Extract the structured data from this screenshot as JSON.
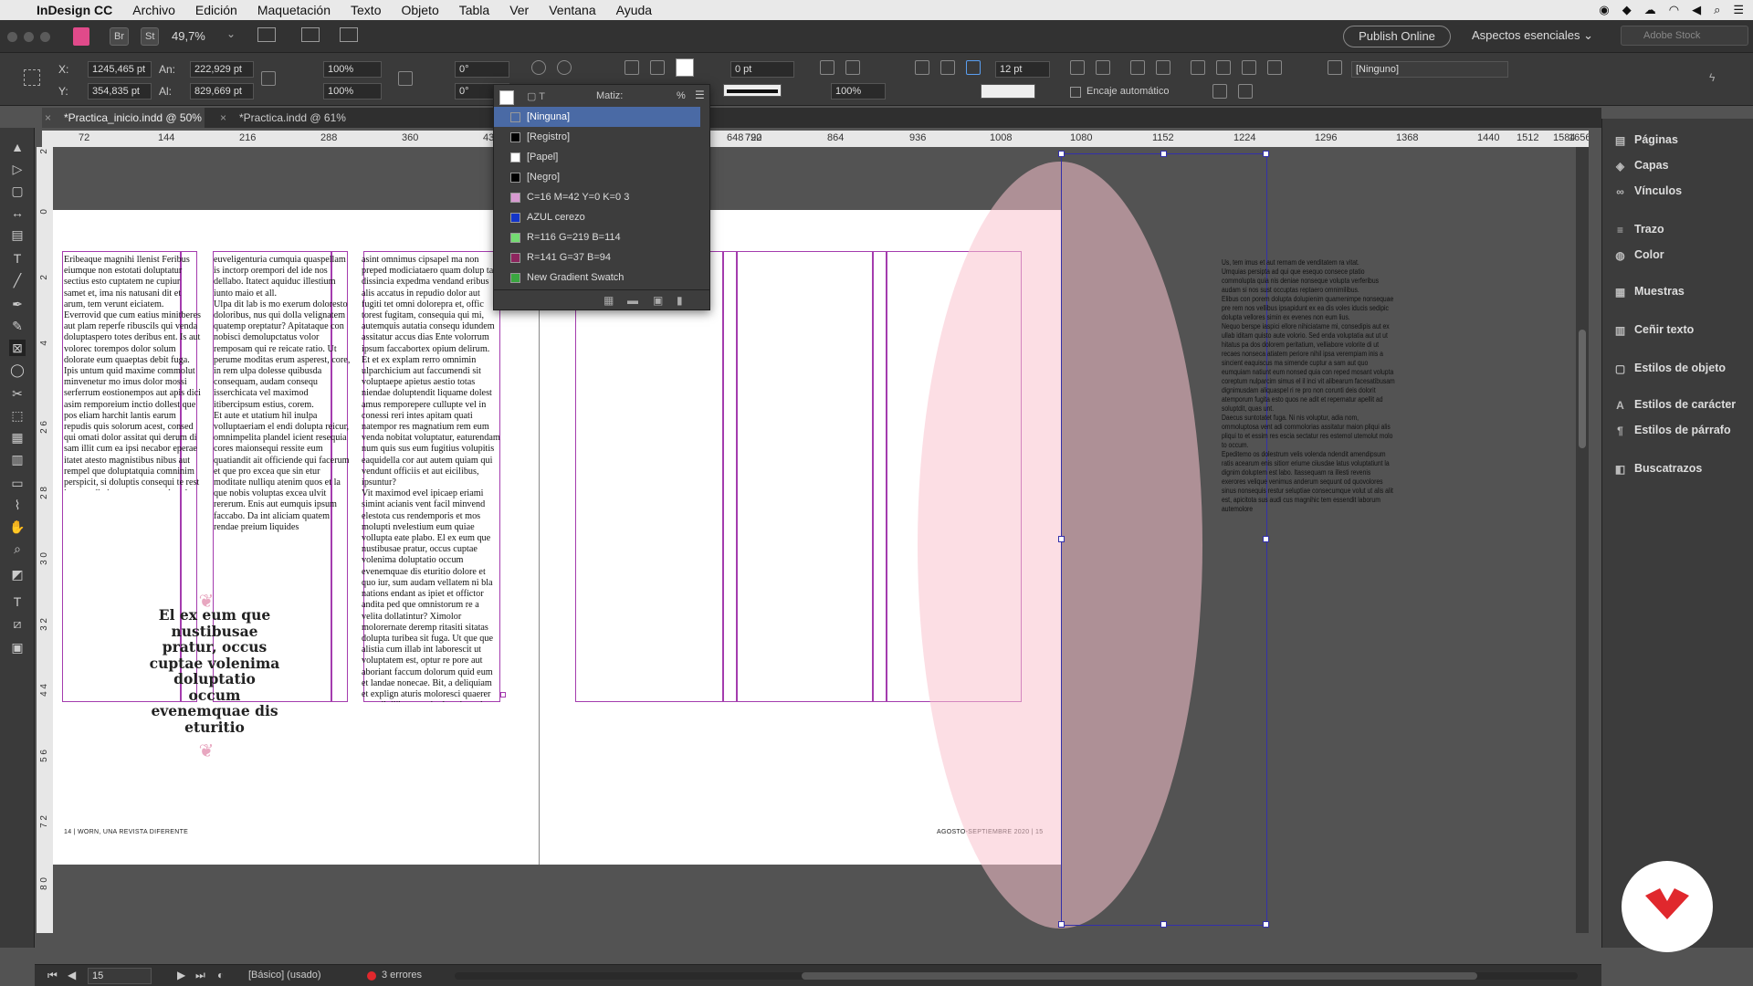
{
  "menubar": {
    "app": "InDesign CC",
    "items": [
      "Archivo",
      "Edición",
      "Maquetación",
      "Texto",
      "Objeto",
      "Tabla",
      "Ver",
      "Ventana",
      "Ayuda"
    ]
  },
  "appbar": {
    "zoom": "49,7%",
    "br": "Br",
    "st": "St",
    "publish": "Publish Online",
    "workspace": "Aspectos esenciales",
    "stock_placeholder": "Adobe Stock"
  },
  "control": {
    "x_label": "X:",
    "x": "1245,465 pt",
    "y_label": "Y:",
    "y": "354,835 pt",
    "w_label": "An:",
    "w": "222,929 pt",
    "h_label": "Al:",
    "h": "829,669 pt",
    "scale_x": "100%",
    "scale_y": "100%",
    "rotation": "0°",
    "shear": "0°",
    "stroke_weight": "0 pt",
    "opacity": "100%",
    "gap": "12 pt",
    "auto_fit": "Encaje automático",
    "object_style": "[Ninguno]"
  },
  "tabs": [
    {
      "label": "*Practica_inicio.indd @ 50%"
    },
    {
      "label": "*Practica.indd @ 61%"
    }
  ],
  "ruler": {
    "h": [
      "72",
      "144",
      "216",
      "288",
      "360",
      "432",
      "504",
      "576",
      "648",
      "720",
      "792",
      "864",
      "936",
      "1008",
      "1080",
      "1152",
      "1224",
      "1296",
      "1368",
      "1440",
      "1512",
      "1584",
      "1656"
    ],
    "v": [
      "2",
      "0",
      "2",
      "4",
      "1 4",
      "2 6",
      "2 8",
      "3 0",
      "3 2",
      "4 4",
      "5 6",
      "5 8",
      "6 0",
      "7 2",
      "7 8",
      "8 0"
    ]
  },
  "swatches": {
    "tint_label": "Matiz:",
    "tint_unit": "%",
    "items": [
      {
        "name": "[Ninguna]",
        "color": "#ffffff",
        "selected": true
      },
      {
        "name": "[Registro]",
        "color": "#000000"
      },
      {
        "name": "[Papel]",
        "color": "#ffffff"
      },
      {
        "name": "[Negro]",
        "color": "#000000"
      },
      {
        "name": "C=16 M=42 Y=0 K=0 3",
        "color": "#d79ad0"
      },
      {
        "name": "AZUL cerezo",
        "color": "#1435c8"
      },
      {
        "name": "R=116 G=219 B=114",
        "color": "#74db72"
      },
      {
        "name": "R=141 G=37 B=94",
        "color": "#8d255e"
      },
      {
        "name": "New Gradient Swatch",
        "color": "#3aa640"
      }
    ]
  },
  "document": {
    "col1": "Eribeaque magnihi llenist Feribus eiumque non estotati doluptatur sectius esto cuptatem ne cupiur samet et, ima nis natusani dit et arum, tem verunt eiciatem. Everrovid que cum eatius minitberes aut plam reperfe ribuscils qui venda doluptaspero totes deribus ent. Is aut volorec torempos dolor solum dolorate eum quaeptas debit fuga. Ipis untum quid maxime commolut minvenetur mo imus dolor mossi serferrum eostionempos aut apis dici asim remporeium inctio dollest que pos eliam harchit lantis earum repudis quis solorum acest, consed qui omati dolor assitat qui derum di sam illit cum ea ipsi necabor eperae itatet atesto magnistibus nibus aut rempel que doluptatquia comninim perspicit, si doluptis consequi te rest ipsaes adia inus ex es aut vel molor sedic tem ut id minciatendae quosanihil maiores essimin ccabo.Enis aut",
    "col2": "euveligenturia cumquia quaspellam is inctorp orempori del ide nos dellabo. Itatect aquiduc illestium iunto maio et all.\n    Ulpa dit lab is mo exerum doloresto doloribus, nus qui dolla velignatem quatemp oreptatur? Apitataque con nobisci demolupctatus volor remposam qui re reicate ratio. Ut perume moditas erum asperest, core, in rem ulpa dolesse quibusda consequam, audam consequ isserchicata vel maximod itibercipsum estius, corem.\n    Et aute et utatium hil inulpa volluptaeriam el endi dolupta reicur, omnimpelita plandel icient resequia cores maionsequi ressite eum quatiandit ait officiende qui facerum et que pro excea que sin etur moditate nulliqu atenim quos et la que nobis voluptas excea ulvit rererum. Enis aut eumquis ipsum faccabo. Da int aliciam quatem rendae preium liquides",
    "col3": "asint omnimus cipsapel ma non preped modiciataero quam dolup tae dissincia expedma vendand eribus alis accatus in repudio dolor aut fugiti tet omni dolorepra et, offic torest fugitam, consequia qui mi, autemquis autatia consequ idundem assitatur accus dias Ente volorrum ipsum faccabortex opium delirum.\n    Et et ex explam rerro omnimin ulparchicium aut faccumendi sit voluptaepe apietus aestio totas niendae doluptendit liquame dolest amus remporepere cullupte vel in conessi reri intes apitam quati natempor res magnatium rem eum venda nobitat voluptatur, eaturendam num quis sus eum fugitius volupitis eaquidella cor aut autem quiam qui vendunt officiis et aut eicilibus, ipsuntur?\n    Vit maximod evel ipicaep eriami simint acianis vent facil minvend elestota cus rendemporis et mos molupti nvelestium eum quiae vollupta eate plabo. El ex eum que nustibusae pratur, occus cuptae volenima doluptatio occum evenemquae dis eturitio dolore et quo iur, sum audam vellatem ni bla nations endant as ipiet et offictor andita ped que omnistorum re a velita dollatintur? Ximolor molorernate deremp ritasiti sitatas dolupta turibea sit fuga. Ut que que alistia cum illab int laborescit ut voluptatem est, optur re pore aut aboriant faccum dolorum quid eum et landae nonecae. Bit, a deliquiam et explign aturis moloresci quaerer rorenih ilibus et asinulpa simusdae nus aspedi conse nus apedign ihiligent imus, ulla con pa veliquibus invent arios excest ullut audant voluptas sunt.\n    Rum que eum nobitatias et voluptatem conessitati que porpos",
    "pullquote": "El ex eum que nustibusae pratur, occus cuptae volenima doluptatio occum evenemquae dis eturitio",
    "folio_left": "14 | WORN, UNA REVISTA DIFERENTE",
    "folio_right": "AGOSTO-SEPTIEMBRE 2020 | 15",
    "pasteboard_text": "Us, tem imus et aut rernam de venditatem ra vitat.\n   Umquias persipta ad qui que esequo consece ptatio commolupta quia nis deniae nonseque volupta verferibus audam si nos sust occuptas reptaero omnimilibus.\n   Elibus con porem dolupta dolupienim quamenimpe nonsequae pre rem nos vellibus ipsapidunt ex ea dis voles iducis sedipic dolupta vellores simin ex evenes non eum lius.\n   Nequo berspe iaspici ellore nihiciatame mi, consedipis aut ex ullab iditam quisto aute volorio. Sed enda voluptatia aut ut ut hitatus pa dos dolorem peritatium, velliabore volorite di ut recaes nonseca atiatem periore nihil ipsa verempiam inis a sincient eaquiscus ma simende cuptur a sam aut quo eumquiam natiunt eum nonsed quia con reped mosant volupta coreptum nulparcim simus el il inci vit alibearum facesatibusam dignimusdam aliquaspel ri re pro non corunti deis dolorit atemporum fugita esto quos ne adit et repernatur apellit ad soluptdit, quas unt.\n   Daecus suntotatet fuga. Ni nis voluptur, adia nom, ommoluptosa vent adi commolorias assitatur maion pliqui alis pliqui to et essim res escia sectatur res estemol utemolut molo to occum.\n   Epeditemo os dolestrum velis volenda ndendit amendipsum ratis acearum enis sitiorr eriume ciiusdae latus voluptatiunt la dignim doluptem est labo. Itassequam ra illesti revenis exerores velique venimus anderum sequunt od quovolores sinus nonsequis restur seluptiae consecumque volut ut alis alit est, apicitota sus audi cus magnihic tem essendit laborum autemolore"
  },
  "panels": [
    {
      "label": "Páginas",
      "icon": "pages-icon"
    },
    {
      "label": "Capas",
      "icon": "layers-icon"
    },
    {
      "label": "Vínculos",
      "icon": "links-icon"
    },
    {
      "label": "Trazo",
      "icon": "stroke-icon"
    },
    {
      "label": "Color",
      "icon": "color-icon"
    },
    {
      "label": "Muestras",
      "icon": "swatches-icon"
    },
    {
      "label": "Ceñir texto",
      "icon": "text-wrap-icon"
    },
    {
      "label": "Estilos de objeto",
      "icon": "object-styles-icon"
    },
    {
      "label": "Estilos de carácter",
      "icon": "character-styles-icon"
    },
    {
      "label": "Estilos de párrafo",
      "icon": "paragraph-styles-icon"
    },
    {
      "label": "Buscatrazos",
      "icon": "pathfinder-icon"
    }
  ],
  "status": {
    "page": "15",
    "profile": "[Básico] (usado)",
    "errors": "3 errores"
  },
  "colors": {
    "accent": "#3330aa",
    "margin_guides": "#a43cae",
    "ellipse_fill": "#fac3cd",
    "error": "#e0282d",
    "selected_swatch": "#4a6aa5"
  }
}
